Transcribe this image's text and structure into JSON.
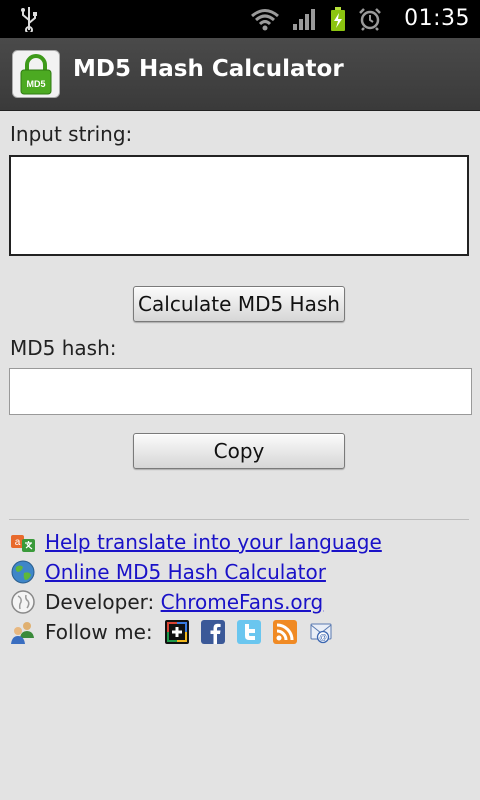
{
  "status_bar": {
    "time": "01:35"
  },
  "app": {
    "title": "MD5 Hash Calculator",
    "icon_label": "MD5"
  },
  "input": {
    "label": "Input string:",
    "value": ""
  },
  "calculate_button": {
    "label": "Calculate MD5 Hash"
  },
  "hash": {
    "label": "MD5 hash:",
    "value": ""
  },
  "copy_button": {
    "label": "Copy"
  },
  "links": {
    "translate": "Help translate into your language",
    "online": "Online MD5 Hash Calculator",
    "developer_prefix": "Developer: ",
    "developer_link": "ChromeFans.org",
    "follow_prefix": "Follow me:"
  },
  "icons": {
    "status": [
      "usb-icon",
      "wifi-icon",
      "signal-icon",
      "battery-charging-icon",
      "alarm-icon"
    ],
    "social": [
      "google-plus-icon",
      "facebook-icon",
      "twitter-icon",
      "rss-icon",
      "email-icon"
    ]
  },
  "colors": {
    "background": "#e3e3e3",
    "title_bar": "#404040",
    "link": "#1a12c8",
    "app_icon_green": "#4caa22"
  }
}
